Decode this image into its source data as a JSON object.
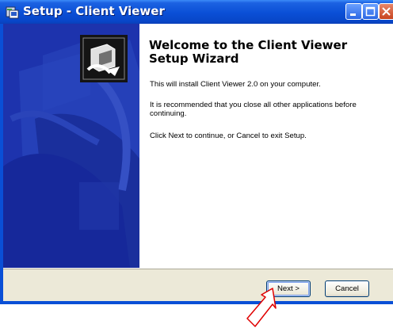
{
  "window": {
    "title": "Setup - Client Viewer"
  },
  "wizard": {
    "heading": "Welcome to the Client Viewer Setup Wizard",
    "paragraphs": [
      "This will install Client Viewer 2.0 on your computer.",
      "It is recommended that you close all other applications before continuing.",
      "Click Next to continue, or Cancel to exit Setup."
    ]
  },
  "buttons": {
    "next_label": "Next >",
    "cancel_label": "Cancel"
  },
  "icons": {
    "app": "setup-app-icon",
    "logo": "installer-computer-icon",
    "pointer": "red-arrow-pointer"
  },
  "colors": {
    "titlebar": "#0a4fd6",
    "side_panel": "#1b2fa8",
    "dialog_face": "#ece9d8",
    "pointer": "#e00000"
  }
}
